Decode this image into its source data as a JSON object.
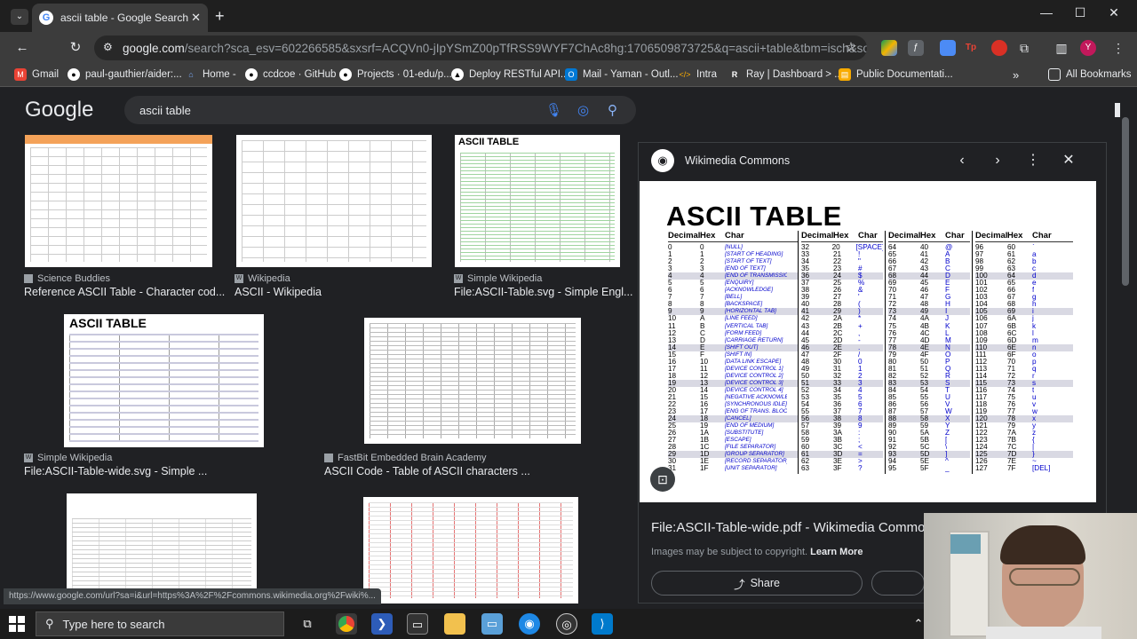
{
  "browser": {
    "tab_title": "ascii table - Google Search",
    "new_tab": "+",
    "close_tab": "✕",
    "url_host": "google.com",
    "url_path": "/search?sca_esv=602266585&sxsrf=ACQVn0-jIpYSmZ00pTfRSS9WYF7ChAc8hg:1706509873725&q=ascii+table&tbm=isch&source=lnms&sa=X..."
  },
  "bookmarks": [
    {
      "label": "Gmail",
      "icon": "gmail-icon",
      "color": "#ea4335"
    },
    {
      "label": "paul-gauthier/aider:...",
      "icon": "github-icon",
      "color": "#ffffff"
    },
    {
      "label": "Home -",
      "icon": "home-icon",
      "color": "#7baaf7"
    },
    {
      "label": "ccdcoe · GitHub",
      "icon": "github-icon",
      "color": "#ffffff"
    },
    {
      "label": "Projects · 01-edu/p...",
      "icon": "github-icon",
      "color": "#ffffff"
    },
    {
      "label": "Deploy RESTful API...",
      "icon": "vercel-icon",
      "color": "#ffffff"
    },
    {
      "label": "Mail - Yaman - Outl...",
      "icon": "outlook-icon",
      "color": "#0078d4"
    },
    {
      "label": "Intra",
      "icon": "code-icon",
      "color": "#f9ab00"
    },
    {
      "label": "Ray | Dashboard > ...",
      "icon": "ray-icon",
      "color": "#ffffff"
    },
    {
      "label": "Public Documentati...",
      "icon": "doc-icon",
      "color": "#f9ab00"
    }
  ],
  "all_bookmarks": "All Bookmarks",
  "google": {
    "logo": "Google",
    "query": "ascii table"
  },
  "results": [
    {
      "source": "Science Buddies",
      "caption": "Reference ASCII Table - Character cod..."
    },
    {
      "source": "Wikipedia",
      "caption": "ASCII - Wikipedia"
    },
    {
      "source": "Simple Wikipedia",
      "caption": "File:ASCII-Table.svg - Simple Engl..."
    },
    {
      "source": "Simple Wikipedia",
      "caption": "File:ASCII-Table-wide.svg - Simple ..."
    },
    {
      "source": "FastBit Embedded Brain Academy",
      "caption": "ASCII Code - Table of ASCII characters ..."
    }
  ],
  "thumb_titles": {
    "simple_wiki": "ASCII TABLE",
    "simple_wiki_wide": "ASCII TABLE"
  },
  "panel": {
    "source": "Wikimedia Commons",
    "image_title": "ASCII TABLE",
    "title": "File:ASCII-Table-wide.pdf - Wikimedia Commons",
    "note": "Images may be subject to copyright.",
    "learn_more": "Learn More",
    "share": "Share",
    "headers": {
      "decimal": "Decimal",
      "hex": "Hex",
      "char": "Char"
    },
    "col1": [
      [
        "0",
        "0",
        "[NULL]"
      ],
      [
        "1",
        "1",
        "[START OF HEADING]"
      ],
      [
        "2",
        "2",
        "[START OF TEXT]"
      ],
      [
        "3",
        "3",
        "[END OF TEXT]"
      ],
      [
        "4",
        "4",
        "[END OF TRANSMISSION]"
      ],
      [
        "5",
        "5",
        "[ENQUIRY]"
      ],
      [
        "6",
        "6",
        "[ACKNOWLEDGE]"
      ],
      [
        "7",
        "7",
        "[BELL]"
      ],
      [
        "8",
        "8",
        "[BACKSPACE]"
      ],
      [
        "9",
        "9",
        "[HORIZONTAL TAB]"
      ],
      [
        "10",
        "A",
        "[LINE FEED]"
      ],
      [
        "11",
        "B",
        "[VERTICAL TAB]"
      ],
      [
        "12",
        "C",
        "[FORM FEED]"
      ],
      [
        "13",
        "D",
        "[CARRIAGE RETURN]"
      ],
      [
        "14",
        "E",
        "[SHIFT OUT]"
      ],
      [
        "15",
        "F",
        "[SHIFT IN]"
      ],
      [
        "16",
        "10",
        "[DATA LINK ESCAPE]"
      ],
      [
        "17",
        "11",
        "[DEVICE CONTROL 1]"
      ],
      [
        "18",
        "12",
        "[DEVICE CONTROL 2]"
      ],
      [
        "19",
        "13",
        "[DEVICE CONTROL 3]"
      ],
      [
        "20",
        "14",
        "[DEVICE CONTROL 4]"
      ],
      [
        "21",
        "15",
        "[NEGATIVE ACKNOWLEDGE]"
      ],
      [
        "22",
        "16",
        "[SYNCHRONOUS IDLE]"
      ],
      [
        "23",
        "17",
        "[ENG OF TRANS. BLOCK]"
      ],
      [
        "24",
        "18",
        "[CANCEL]"
      ],
      [
        "25",
        "19",
        "[END OF MEDIUM]"
      ],
      [
        "26",
        "1A",
        "[SUBSTITUTE]"
      ],
      [
        "27",
        "1B",
        "[ESCAPE]"
      ],
      [
        "28",
        "1C",
        "[FILE SEPARATOR]"
      ],
      [
        "29",
        "1D",
        "[GROUP SEPARATOR]"
      ],
      [
        "30",
        "1E",
        "[RECORD SEPARATOR]"
      ],
      [
        "31",
        "1F",
        "[UNIT SEPARATOR]"
      ]
    ],
    "col2": [
      [
        "32",
        "20",
        "[SPACE]"
      ],
      [
        "33",
        "21",
        "!"
      ],
      [
        "34",
        "22",
        "\""
      ],
      [
        "35",
        "23",
        "#"
      ],
      [
        "36",
        "24",
        "$"
      ],
      [
        "37",
        "25",
        "%"
      ],
      [
        "38",
        "26",
        "&"
      ],
      [
        "39",
        "27",
        "'"
      ],
      [
        "40",
        "28",
        "("
      ],
      [
        "41",
        "29",
        ")"
      ],
      [
        "42",
        "2A",
        "*"
      ],
      [
        "43",
        "2B",
        "+"
      ],
      [
        "44",
        "2C",
        ","
      ],
      [
        "45",
        "2D",
        "-"
      ],
      [
        "46",
        "2E",
        "."
      ],
      [
        "47",
        "2F",
        "/"
      ],
      [
        "48",
        "30",
        "0"
      ],
      [
        "49",
        "31",
        "1"
      ],
      [
        "50",
        "32",
        "2"
      ],
      [
        "51",
        "33",
        "3"
      ],
      [
        "52",
        "34",
        "4"
      ],
      [
        "53",
        "35",
        "5"
      ],
      [
        "54",
        "36",
        "6"
      ],
      [
        "55",
        "37",
        "7"
      ],
      [
        "56",
        "38",
        "8"
      ],
      [
        "57",
        "39",
        "9"
      ],
      [
        "58",
        "3A",
        ":"
      ],
      [
        "59",
        "3B",
        ";"
      ],
      [
        "60",
        "3C",
        "<"
      ],
      [
        "61",
        "3D",
        "="
      ],
      [
        "62",
        "3E",
        ">"
      ],
      [
        "63",
        "3F",
        "?"
      ]
    ],
    "col3": [
      [
        "64",
        "40",
        "@"
      ],
      [
        "65",
        "41",
        "A"
      ],
      [
        "66",
        "42",
        "B"
      ],
      [
        "67",
        "43",
        "C"
      ],
      [
        "68",
        "44",
        "D"
      ],
      [
        "69",
        "45",
        "E"
      ],
      [
        "70",
        "46",
        "F"
      ],
      [
        "71",
        "47",
        "G"
      ],
      [
        "72",
        "48",
        "H"
      ],
      [
        "73",
        "49",
        "I"
      ],
      [
        "74",
        "4A",
        "J"
      ],
      [
        "75",
        "4B",
        "K"
      ],
      [
        "76",
        "4C",
        "L"
      ],
      [
        "77",
        "4D",
        "M"
      ],
      [
        "78",
        "4E",
        "N"
      ],
      [
        "79",
        "4F",
        "O"
      ],
      [
        "80",
        "50",
        "P"
      ],
      [
        "81",
        "51",
        "Q"
      ],
      [
        "82",
        "52",
        "R"
      ],
      [
        "83",
        "53",
        "S"
      ],
      [
        "84",
        "54",
        "T"
      ],
      [
        "85",
        "55",
        "U"
      ],
      [
        "86",
        "56",
        "V"
      ],
      [
        "87",
        "57",
        "W"
      ],
      [
        "88",
        "58",
        "X"
      ],
      [
        "89",
        "59",
        "Y"
      ],
      [
        "90",
        "5A",
        "Z"
      ],
      [
        "91",
        "5B",
        "["
      ],
      [
        "92",
        "5C",
        "\\"
      ],
      [
        "93",
        "5D",
        "]"
      ],
      [
        "94",
        "5E",
        "^"
      ],
      [
        "95",
        "5F",
        "_"
      ]
    ],
    "col4": [
      [
        "96",
        "60",
        "`"
      ],
      [
        "97",
        "61",
        "a"
      ],
      [
        "98",
        "62",
        "b"
      ],
      [
        "99",
        "63",
        "c"
      ],
      [
        "100",
        "64",
        "d"
      ],
      [
        "101",
        "65",
        "e"
      ],
      [
        "102",
        "66",
        "f"
      ],
      [
        "103",
        "67",
        "g"
      ],
      [
        "104",
        "68",
        "h"
      ],
      [
        "105",
        "69",
        "i"
      ],
      [
        "106",
        "6A",
        "j"
      ],
      [
        "107",
        "6B",
        "k"
      ],
      [
        "108",
        "6C",
        "l"
      ],
      [
        "109",
        "6D",
        "m"
      ],
      [
        "110",
        "6E",
        "n"
      ],
      [
        "111",
        "6F",
        "o"
      ],
      [
        "112",
        "70",
        "p"
      ],
      [
        "113",
        "71",
        "q"
      ],
      [
        "114",
        "72",
        "r"
      ],
      [
        "115",
        "73",
        "s"
      ],
      [
        "116",
        "74",
        "t"
      ],
      [
        "117",
        "75",
        "u"
      ],
      [
        "118",
        "76",
        "v"
      ],
      [
        "119",
        "77",
        "w"
      ],
      [
        "120",
        "78",
        "x"
      ],
      [
        "121",
        "79",
        "y"
      ],
      [
        "122",
        "7A",
        "z"
      ],
      [
        "123",
        "7B",
        "{"
      ],
      [
        "124",
        "7C",
        "|"
      ],
      [
        "125",
        "7D",
        "}"
      ],
      [
        "126",
        "7E",
        "~"
      ],
      [
        "127",
        "7F",
        "[DEL]"
      ]
    ]
  },
  "status_url": "https://www.google.com/url?sa=i&url=https%3A%2F%2Fcommons.wikimedia.org%2Fwiki%...",
  "taskbar": {
    "search_placeholder": "Type here to search"
  }
}
